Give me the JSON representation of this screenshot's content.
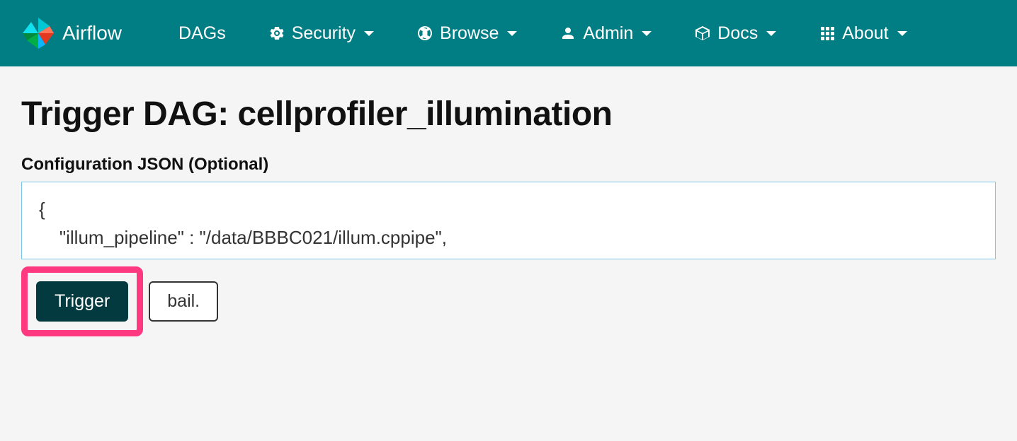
{
  "navbar": {
    "brand": "Airflow",
    "items": [
      {
        "label": "DAGs",
        "has_caret": false,
        "icon": null
      },
      {
        "label": "Security",
        "has_caret": true,
        "icon": "gears"
      },
      {
        "label": "Browse",
        "has_caret": true,
        "icon": "globe"
      },
      {
        "label": "Admin",
        "has_caret": true,
        "icon": "user"
      },
      {
        "label": "Docs",
        "has_caret": true,
        "icon": "cube"
      },
      {
        "label": "About",
        "has_caret": true,
        "icon": "grid"
      }
    ]
  },
  "page": {
    "title": "Trigger DAG: cellprofiler_illumination",
    "config_label": "Configuration JSON (Optional)",
    "config_value": "{\n    \"illum_pipeline\" : \"/data/BBBC021/illum.cppipe\",",
    "trigger_button": "Trigger",
    "bail_button": "bail."
  }
}
